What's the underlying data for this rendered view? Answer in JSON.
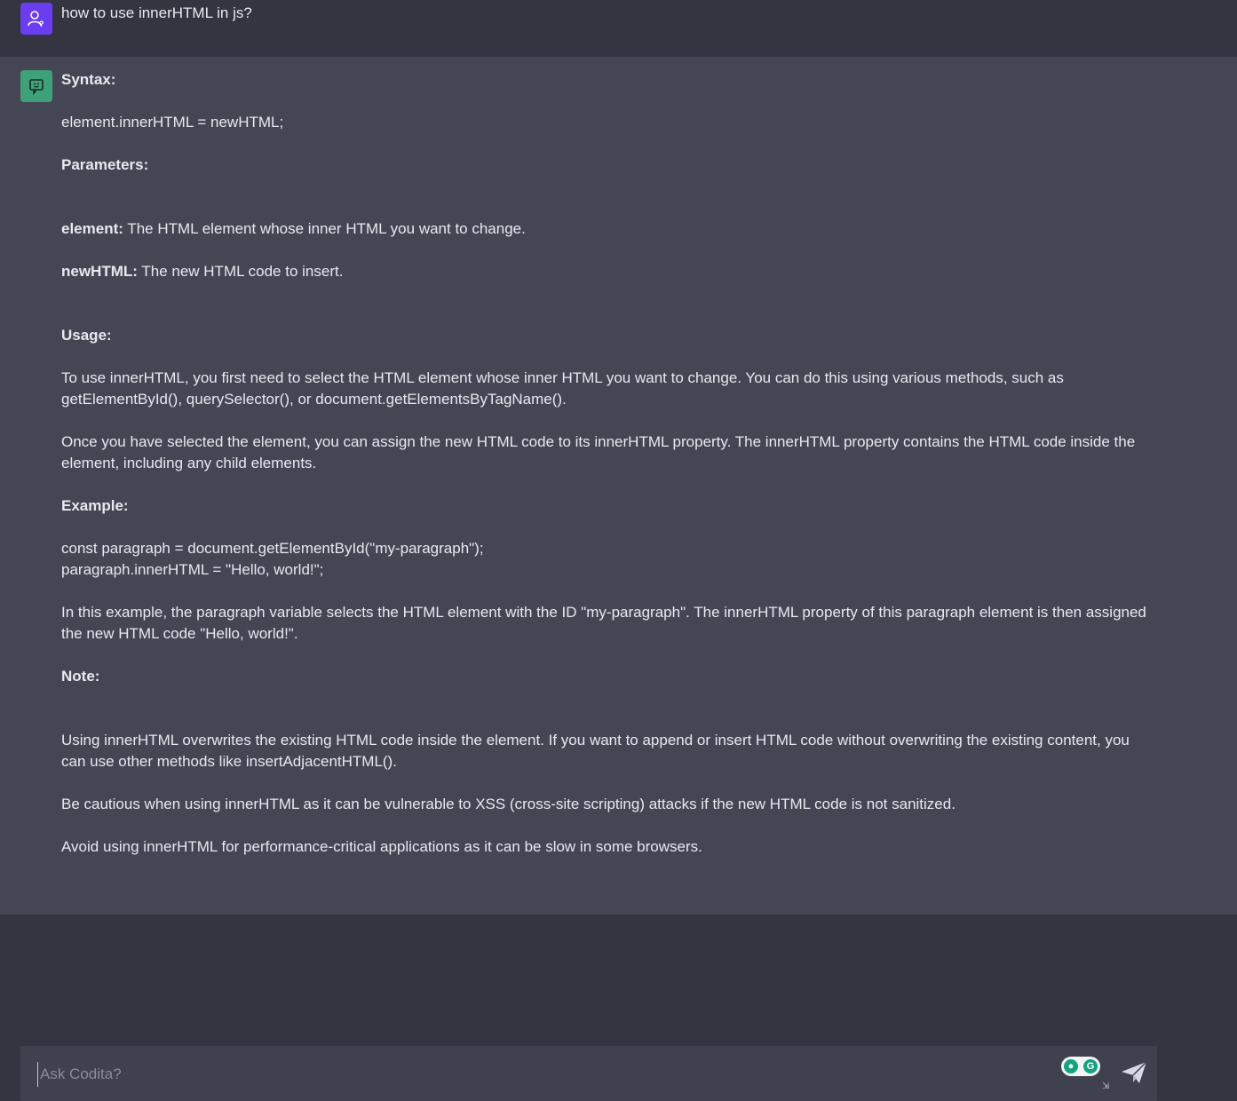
{
  "user_message": {
    "text": "how to use innerHTML in js?"
  },
  "bot_message": {
    "syntax_heading": "Syntax:",
    "syntax_code": "element.innerHTML = newHTML;",
    "parameters_heading": "Parameters:",
    "param_element_name": "element:",
    "param_element_desc": " The HTML element whose inner HTML you want to change.",
    "param_newhtml_name": "newHTML:",
    "param_newhtml_desc": " The new HTML code to insert.",
    "usage_heading": "Usage:",
    "usage_p1": "To use innerHTML, you first need to select the HTML element whose inner HTML you want to change. You can do this using various methods, such as getElementById(), querySelector(), or document.getElementsByTagName().",
    "usage_p2": "Once you have selected the element, you can assign the new HTML code to its innerHTML property. The innerHTML property contains the HTML code inside the element, including any child elements.",
    "example_heading": "Example:",
    "example_line1": "const paragraph = document.getElementById(\"my-paragraph\");",
    "example_line2": "paragraph.innerHTML = \"Hello, world!\";",
    "example_explanation": "In this example, the paragraph variable selects the HTML element with the ID \"my-paragraph\". The innerHTML property of this paragraph element is then assigned the new HTML code \"Hello, world!\".",
    "note_heading": "Note:",
    "note_p1": "Using innerHTML overwrites the existing HTML code inside the element. If you want to append or insert HTML code without overwriting the existing content, you can use other methods like insertAdjacentHTML().",
    "note_p2": "Be cautious when using innerHTML as it can be vulnerable to XSS (cross-site scripting) attacks if the new HTML code is not sanitized.",
    "note_p3": "Avoid using innerHTML for performance-critical applications as it can be slow in some browsers."
  },
  "composer": {
    "placeholder": "Ask Codita?"
  },
  "icons": {
    "user_avatar": "user-question-icon",
    "bot_avatar": "chat-bot-icon",
    "grammar": "grammarly-badge-icon",
    "send": "paper-plane-icon"
  },
  "colors": {
    "background": "#343541",
    "bot_row": "#444654",
    "user_avatar_bg": "#6a3df0",
    "bot_avatar_bg": "#3fa17a",
    "input_bg": "#40414f"
  }
}
